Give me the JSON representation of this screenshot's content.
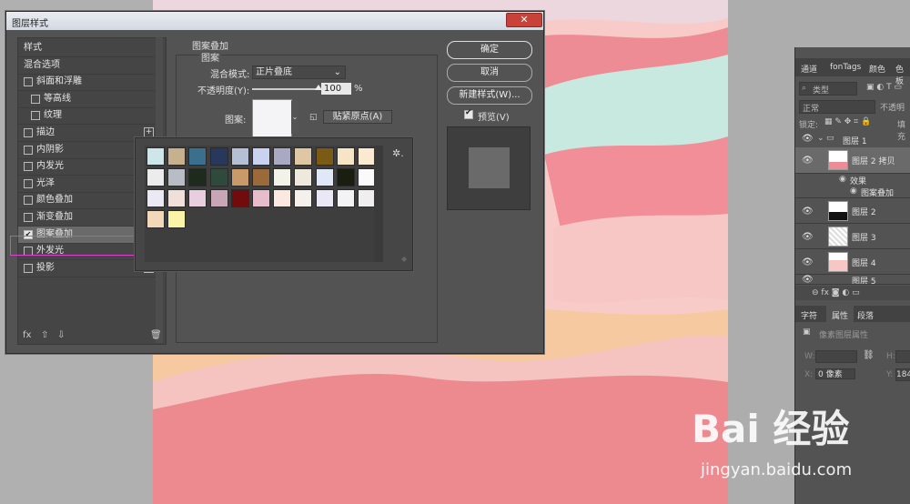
{
  "dialog": {
    "title": "图层样式",
    "close_label": "✕",
    "left_list": [
      {
        "label": "样式",
        "checkbox": false,
        "indent": false,
        "plus": false
      },
      {
        "label": "混合选项",
        "checkbox": false,
        "indent": false,
        "plus": false
      },
      {
        "label": "斜面和浮雕",
        "checkbox": true,
        "checked": false,
        "indent": false,
        "plus": false
      },
      {
        "label": "等高线",
        "checkbox": true,
        "checked": false,
        "indent": true,
        "plus": false
      },
      {
        "label": "纹理",
        "checkbox": true,
        "checked": false,
        "indent": true,
        "plus": false
      },
      {
        "label": "描边",
        "checkbox": true,
        "checked": false,
        "indent": false,
        "plus": true
      },
      {
        "label": "内阴影",
        "checkbox": true,
        "checked": false,
        "indent": false,
        "plus": false
      },
      {
        "label": "内发光",
        "checkbox": true,
        "checked": false,
        "indent": false,
        "plus": false
      },
      {
        "label": "光泽",
        "checkbox": true,
        "checked": false,
        "indent": false,
        "plus": false
      },
      {
        "label": "颜色叠加",
        "checkbox": true,
        "checked": false,
        "indent": false,
        "plus": false
      },
      {
        "label": "渐变叠加",
        "checkbox": true,
        "checked": false,
        "indent": false,
        "plus": false
      },
      {
        "label": "图案叠加",
        "checkbox": true,
        "checked": true,
        "indent": false,
        "plus": false,
        "selected": true
      },
      {
        "label": "外发光",
        "checkbox": true,
        "checked": false,
        "indent": false,
        "plus": false
      },
      {
        "label": "投影",
        "checkbox": true,
        "checked": false,
        "indent": false,
        "plus": true
      }
    ],
    "bottom_icons": {
      "fx": "fx",
      "up": "⇧",
      "down": "⇩",
      "trash": "🗑"
    },
    "group_title": "图案叠加",
    "subgroup_title": "图案",
    "blend_label": "混合模式:",
    "blend_value": "正片叠底",
    "opacity_label": "不透明度(Y):",
    "opacity_value": "100",
    "opacity_unit": "%",
    "opacity_level": 1.0,
    "pattern_label": "图案:",
    "snap_label": "贴紧原点(A)",
    "ok_label": "确定",
    "cancel_label": "取消",
    "new_style_label": "新建样式(W)...",
    "preview_label": "预览(V)",
    "preview_checked": true
  },
  "pattern_swatches": [
    "#cde6ea",
    "#c5b18e",
    "#3b6f8e",
    "#27385a",
    "#b6c0d4",
    "#c9d3ef",
    "#a9a9c3",
    "#e0c7a3",
    "#7a5a14",
    "#f5e4c6",
    "#f9ead1",
    "#ececec",
    "#b8bcc4",
    "#1e2a1e",
    "#2f4a3c",
    "#c89a6a",
    "#9a6a3a",
    "#f2f2e8",
    "#efe8dc",
    "#e0e8f8",
    "#1a1e10",
    "#fafafa",
    "#ebe9f4",
    "#f1e0d9",
    "#e8cfe0",
    "#c9a5b8",
    "#720c0c",
    "#e7bccb",
    "#fbe9e0",
    "#f5f0ec",
    "#eae8f6",
    "#f3f3f5",
    "#f0eeee",
    "#f2d7b8",
    "#fbf3a6"
  ],
  "layers_panel": {
    "tabs": [
      "通道",
      "fonTags",
      "颜色",
      "色板"
    ],
    "filter_label": "类型",
    "mode_label": "正常",
    "opacity_label": "不透明",
    "lock_label": "锁定:",
    "fill_label": "填充",
    "layers": [
      {
        "name": "图层 1",
        "type": "group"
      },
      {
        "name": "图层 2 拷贝",
        "type": "layer",
        "selected": true
      },
      {
        "name": "效果",
        "type": "effect"
      },
      {
        "name": "图案叠加",
        "type": "effect"
      },
      {
        "name": "图层 2",
        "type": "layer"
      },
      {
        "name": "图层 3",
        "type": "layer"
      },
      {
        "name": "图层 4",
        "type": "layer"
      },
      {
        "name": "图层 5",
        "type": "layer"
      }
    ],
    "props_tabs": [
      "字符",
      "属性",
      "段落"
    ],
    "props_title": "像素图层属性",
    "w_label": "W:",
    "h_label": "H:",
    "x_label": "X:",
    "x_value": "0 像素",
    "y_label": "Y:",
    "y_value": "184"
  },
  "watermark": {
    "brand": "Bai 经验",
    "url": "jingyan.baidu.com"
  }
}
